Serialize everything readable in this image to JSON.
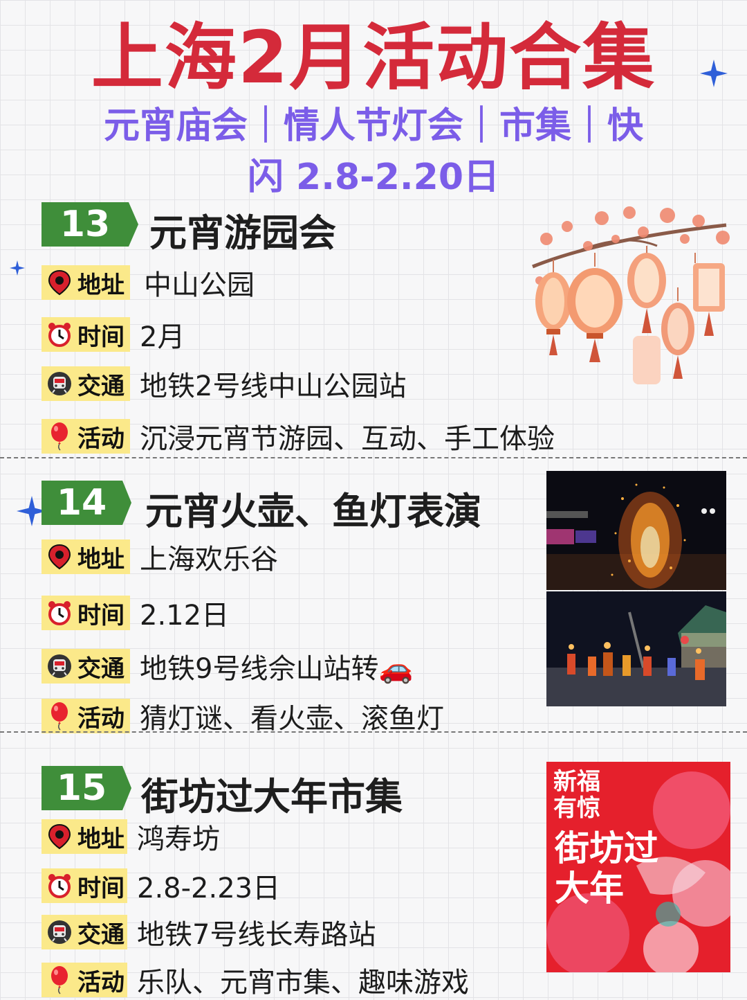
{
  "title": "上海2月活动合集",
  "subtitle_line1": "元宵庙会｜情人节灯会｜市集｜快",
  "subtitle_line2": "闪 2.8-2.20日",
  "sections": [
    {
      "num": "13",
      "title": "元宵游园会",
      "rows": [
        {
          "label": "地址",
          "value": "中山公园"
        },
        {
          "label": "时间",
          "value": "2月"
        },
        {
          "label": "交通",
          "value": "地铁2号线中山公园站"
        },
        {
          "label": "活动",
          "value": "沉浸元宵节游园、互动、手工体验"
        }
      ]
    },
    {
      "num": "14",
      "title": "元宵火壶、鱼灯表演",
      "rows": [
        {
          "label": "地址",
          "value": "上海欢乐谷"
        },
        {
          "label": "时间",
          "value": "2.12日"
        },
        {
          "label": "交通",
          "value": "地铁9号线佘山站转🚗"
        },
        {
          "label": "活动",
          "value": "猜灯谜、看火壶、滚鱼灯"
        }
      ]
    },
    {
      "num": "15",
      "title": "街坊过大年市集",
      "rows": [
        {
          "label": "地址",
          "value": "鸿寿坊"
        },
        {
          "label": "时间",
          "value": "2.8-2.23日"
        },
        {
          "label": "交通",
          "value": "地铁7号线长寿路站"
        },
        {
          "label": "活动",
          "value": "乐队、元宵市集、趣味游戏"
        }
      ]
    }
  ],
  "poster": {
    "text1": "新福有惊",
    "text2": "街坊过大年"
  },
  "icons": [
    "map-pin-icon",
    "alarm-clock-icon",
    "metro-icon",
    "balloon-icon",
    "sparkle-icon"
  ],
  "colors": {
    "title": "#d42a3a",
    "subtitle": "#7b5de8",
    "badge": "#3f8e3a",
    "label_bg": "#fbe98a"
  }
}
